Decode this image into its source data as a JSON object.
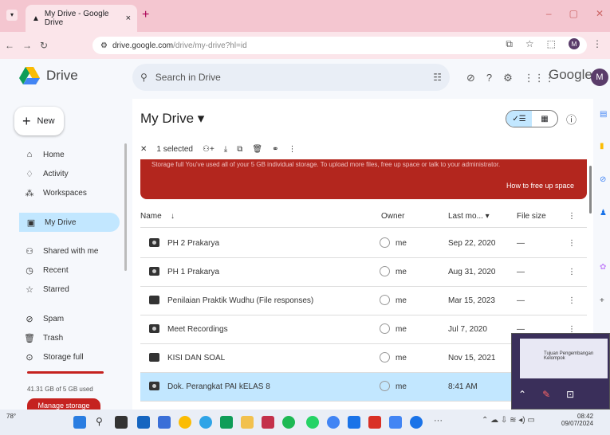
{
  "browser": {
    "tab_title": "My Drive - Google Drive",
    "tab_close": "×",
    "new_tab": "+",
    "url_host": "drive.google.com",
    "url_path": "/drive/my-drive?hl=id",
    "window_controls": [
      "–",
      "▢",
      "✕"
    ]
  },
  "header": {
    "app_name": "Drive",
    "search_placeholder": "Search in Drive",
    "google_text": "Google",
    "avatar_letter": "M"
  },
  "sidebar": {
    "new_label": "New",
    "items": [
      {
        "label": "Home",
        "icon": "⌂"
      },
      {
        "label": "Activity",
        "icon": "♢"
      },
      {
        "label": "Workspaces",
        "icon": "⁂"
      },
      {
        "label": "My Drive",
        "icon": "▣"
      },
      {
        "label": "Shared with me",
        "icon": "⚇"
      },
      {
        "label": "Recent",
        "icon": "◷"
      },
      {
        "label": "Starred",
        "icon": "☆"
      },
      {
        "label": "Spam",
        "icon": "⊘"
      },
      {
        "label": "Trash",
        "icon": "🗑"
      },
      {
        "label": "Storage full",
        "icon": "⊙"
      }
    ],
    "storage_text": "41.31 GB of 5 GB used",
    "manage_label": "Manage storage"
  },
  "main": {
    "title": "My Drive ▾",
    "selection": "1 selected",
    "banner_message": "Storage full You've used all of your 5 GB individual storage. To upload more files, free up space or talk to your administrator.",
    "banner_action": "How to free up space",
    "columns": {
      "name": "Name",
      "sort_arrow": "↓",
      "owner": "Owner",
      "modified": "Last mo... ▾",
      "size": "File size"
    },
    "rows": [
      {
        "name": "PH 2 Prakarya",
        "owner": "me",
        "modified": "Sep 22, 2020",
        "size": "—",
        "shared": true
      },
      {
        "name": "PH 1 Prakarya",
        "owner": "me",
        "modified": "Aug 31, 2020",
        "size": "—",
        "shared": true
      },
      {
        "name": "Penilaian Praktik Wudhu (File responses)",
        "owner": "me",
        "modified": "Mar 15, 2023",
        "size": "—",
        "shared": false
      },
      {
        "name": "Meet Recordings",
        "owner": "me",
        "modified": "Jul 7, 2020",
        "size": "—",
        "shared": true
      },
      {
        "name": "KISI DAN SOAL",
        "owner": "me",
        "modified": "Nov 15, 2021",
        "size": "—",
        "shared": false
      },
      {
        "name": "Dok. Perangkat PAI kELAS 8",
        "owner": "me",
        "modified": "8:41 AM",
        "size": "—",
        "shared": true
      }
    ]
  },
  "overlay": {
    "caption": "Tujuan Pengembangan Kelompok"
  },
  "taskbar": {
    "weather": "78°",
    "time": "08:42",
    "date": "09/07/2024"
  }
}
